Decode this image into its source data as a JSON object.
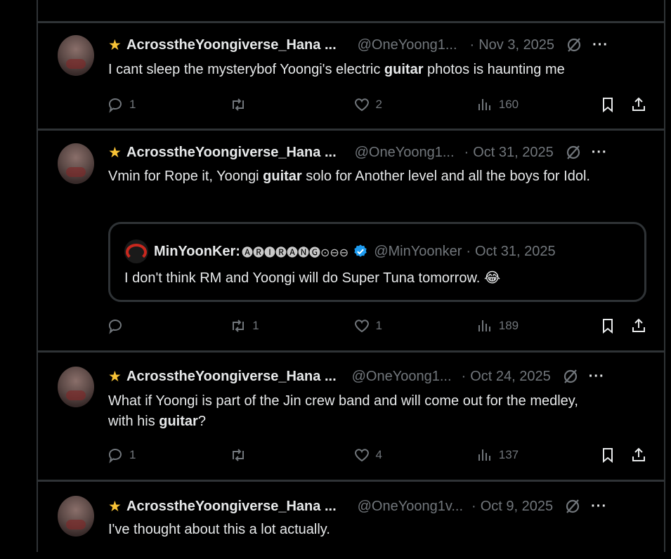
{
  "tweets": [
    {
      "name": "AcrosstheYoongiverse_Hana ...",
      "handle": "@OneYoong1...",
      "date": "Nov 3, 2025",
      "text_before": "I cant sleep the mysterybof Yoongi's electric ",
      "highlight": "guitar",
      "text_after": " photos is haunting me",
      "replies": "1",
      "retweets": "",
      "likes": "2",
      "views": "160"
    },
    {
      "name": "AcrosstheYoongiverse_Hana ...",
      "handle": "@OneYoong1...",
      "date": "Oct 31, 2025",
      "text_before": "Vmin for Rope it, Yoongi ",
      "highlight": "guitar",
      "text_after": " solo for Another level and  all the boys for Idol.",
      "replies": "",
      "retweets": "1",
      "likes": "1",
      "views": "189",
      "quote": {
        "name": "MinYoonKer:",
        "badges": "🅐🅡🅘🅡🅐🅝🅖⊙⊖⊖",
        "handle": "@MinYoonker",
        "date": "Oct 31, 2025",
        "text": "I don't think RM and Yoongi will do Super Tuna tomorrow. ",
        "emoji": "😂"
      }
    },
    {
      "name": "AcrosstheYoongiverse_Hana ...",
      "handle": "@OneYoong1...",
      "date": "Oct 24, 2025",
      "text_before": "What if Yoongi is part of the Jin crew band and will come out for the medley, with his ",
      "highlight": "guitar",
      "text_after": "?",
      "replies": "1",
      "retweets": "",
      "likes": "4",
      "views": "137"
    },
    {
      "name": "AcrosstheYoongiverse_Hana ...",
      "handle": "@OneYoong1v...",
      "date": "Oct 9, 2025",
      "text_before": "I've thought about this a lot actually.",
      "highlight": "",
      "text_after": ""
    }
  ],
  "icons": {
    "reply": "reply-icon",
    "retweet": "retweet-icon",
    "like": "heart-icon",
    "views": "views-icon",
    "bookmark": "bookmark-icon",
    "share": "share-icon",
    "grok": "grok-icon",
    "more": "more-icon",
    "star": "shooting-star-icon"
  },
  "colors": {
    "background": "#000000",
    "text": "#e7e9ea",
    "muted": "#71767b",
    "border": "#2f3336",
    "verified": "#1d9bf0"
  }
}
